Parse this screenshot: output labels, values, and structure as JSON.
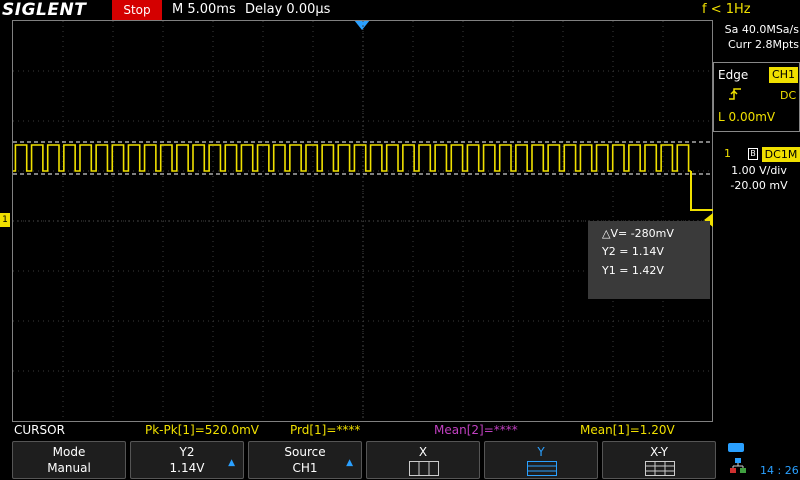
{
  "header": {
    "brand": "SIGLENT",
    "run_state": "Stop",
    "timebase": "M 5.00ms",
    "delay": "Delay 0.00μs",
    "frequency": "f < 1Hz"
  },
  "acquisition": {
    "sample_rate": "Sa 40.0MSa/s",
    "memory_depth": "Curr 2.8Mpts"
  },
  "trigger": {
    "type": "Edge",
    "source": "CH1",
    "coupling": "DC",
    "level": "L  0.00mV",
    "slope_icon": "rising-edge-icon"
  },
  "channel1": {
    "number": "1",
    "bw_icon": "B",
    "coupling": "DC1M",
    "scale": "1.00 V/div",
    "offset": "-20.00 mV",
    "color": "#f0e000",
    "offset_marker": "1"
  },
  "cursor_readout": {
    "delta_v": "△V= -280mV",
    "y2": "Y2 = 1.14V",
    "y1": "Y1 = 1.42V"
  },
  "measurements": {
    "menu_title": "CURSOR",
    "pkpk": "Pk-Pk[1]=520.0mV",
    "prd": "Prd[1]=****",
    "mean2": "Mean[2]=****",
    "mean1": "Mean[1]=1.20V",
    "mean2_color": "#c040c0"
  },
  "menu": {
    "mode_label": "Mode",
    "mode_value": "Manual",
    "y2_label": "Y2",
    "y2_value": "1.14V",
    "source_label": "Source",
    "source_value": "CH1",
    "x_label": "X",
    "y_label": "Y",
    "xy_label": "X-Y"
  },
  "status": {
    "clock": "14 : 26",
    "battery_icon": "battery-icon",
    "network_icon": "lan-icon"
  },
  "waveform": {
    "high_level_div": 1.52,
    "low_level_div": 1.0,
    "cycles": 42
  }
}
